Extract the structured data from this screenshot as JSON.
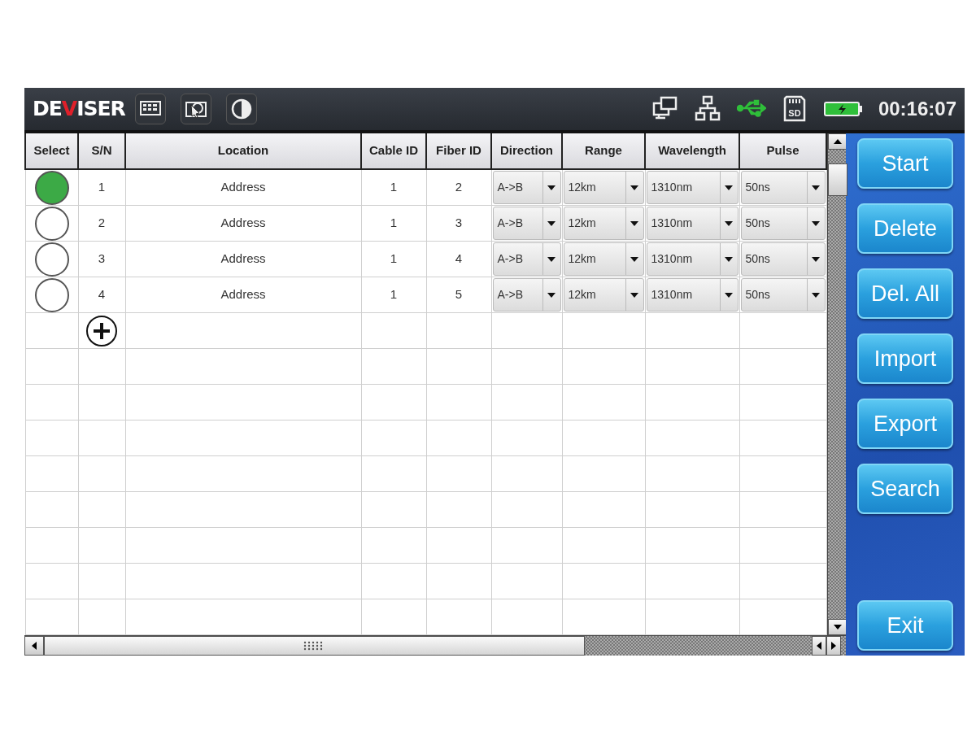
{
  "top_bar": {
    "logo": [
      {
        "text": "DE",
        "color": "#ffffff"
      },
      {
        "text": "V",
        "color": "#e0202a"
      },
      {
        "text": "ISER",
        "color": "#ffffff"
      }
    ],
    "sd_card_label": "SD",
    "time": "00:16:07"
  },
  "table": {
    "columns": [
      "Select",
      "S/N",
      "Location",
      "Cable ID",
      "Fiber ID",
      "Direction",
      "Range",
      "Wavelength",
      "Pulse"
    ],
    "rows": [
      {
        "selected": true,
        "sn": "1",
        "location": "Address",
        "cable_id": "1",
        "fiber_id": "2",
        "direction": "A->B",
        "range": "12km",
        "wavelength": "1310nm",
        "pulse": "50ns"
      },
      {
        "selected": false,
        "sn": "2",
        "location": "Address",
        "cable_id": "1",
        "fiber_id": "3",
        "direction": "A->B",
        "range": "12km",
        "wavelength": "1310nm",
        "pulse": "50ns"
      },
      {
        "selected": false,
        "sn": "3",
        "location": "Address",
        "cable_id": "1",
        "fiber_id": "4",
        "direction": "A->B",
        "range": "12km",
        "wavelength": "1310nm",
        "pulse": "50ns"
      },
      {
        "selected": false,
        "sn": "4",
        "location": "Address",
        "cable_id": "1",
        "fiber_id": "5",
        "direction": "A->B",
        "range": "12km",
        "wavelength": "1310nm",
        "pulse": "50ns"
      }
    ]
  },
  "buttons": [
    "Start",
    "Delete",
    "Del. All",
    "Import",
    "Export",
    "Search"
  ],
  "exit_button": "Exit"
}
